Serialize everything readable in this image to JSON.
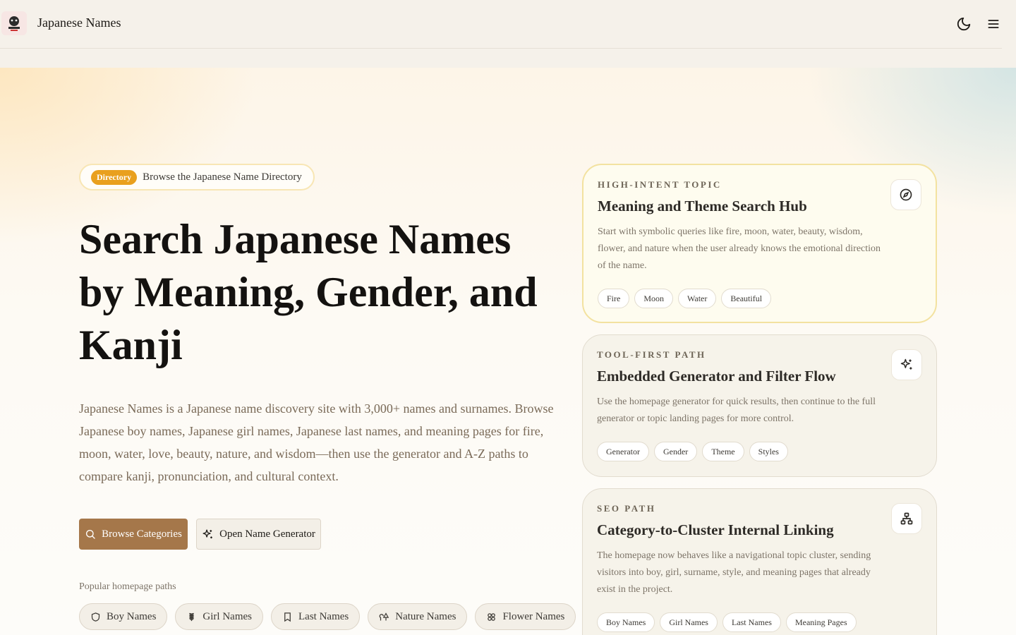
{
  "header": {
    "site_title": "Japanese Names",
    "logo_icon": "site-logo",
    "theme_toggle_icon": "moon-icon",
    "menu_icon": "menu-icon"
  },
  "hero": {
    "badge_pill": "Directory",
    "badge_text": "Browse the Japanese Name Directory",
    "title": "Search Japanese Names by Meaning, Gender, and Kanji",
    "description": "Japanese Names is a Japanese name discovery site with 3,000+ names and surnames. Browse Japanese boy names, Japanese girl names, Japanese last names, and meaning pages for fire, moon, water, love, beauty, nature, and wisdom—then use the generator and A-Z paths to compare kanji, pronunciation, and cultural context.",
    "primary_button": "Browse Categories",
    "secondary_button": "Open Name Generator",
    "popular_label": "Popular homepage paths",
    "chips": [
      {
        "label": "Boy Names",
        "icon": "shield-icon"
      },
      {
        "label": "Girl Names",
        "icon": "flower-stem-icon"
      },
      {
        "label": "Last Names",
        "icon": "bookmark-icon"
      },
      {
        "label": "Nature Names",
        "icon": "trees-icon"
      },
      {
        "label": "Flower Names",
        "icon": "clover-icon"
      }
    ]
  },
  "cards": [
    {
      "kicker": "High-Intent Topic",
      "title": "Meaning and Theme Search Hub",
      "description": "Start with symbolic queries like fire, moon, water, beauty, wisdom, flower, and nature when the user already knows the emotional direction of the name.",
      "icon": "compass-icon",
      "tags": [
        "Fire",
        "Moon",
        "Water",
        "Beautiful"
      ]
    },
    {
      "kicker": "Tool-First Path",
      "title": "Embedded Generator and Filter Flow",
      "description": "Use the homepage generator for quick results, then continue to the full generator or topic landing pages for more control.",
      "icon": "sparkles-icon",
      "tags": [
        "Generator",
        "Gender",
        "Theme",
        "Styles"
      ]
    },
    {
      "kicker": "SEO Path",
      "title": "Category-to-Cluster Internal Linking",
      "description": "The homepage now behaves like a navigational topic cluster, sending visitors into boy, girl, surname, style, and meaning pages that already exist in the project.",
      "icon": "network-icon",
      "tags": [
        "Boy Names",
        "Girl Names",
        "Last Names",
        "Meaning Pages"
      ]
    }
  ],
  "colors": {
    "accent": "#a5774a",
    "badge": "#e9a01e",
    "highlight_border": "#f3e2a0"
  }
}
